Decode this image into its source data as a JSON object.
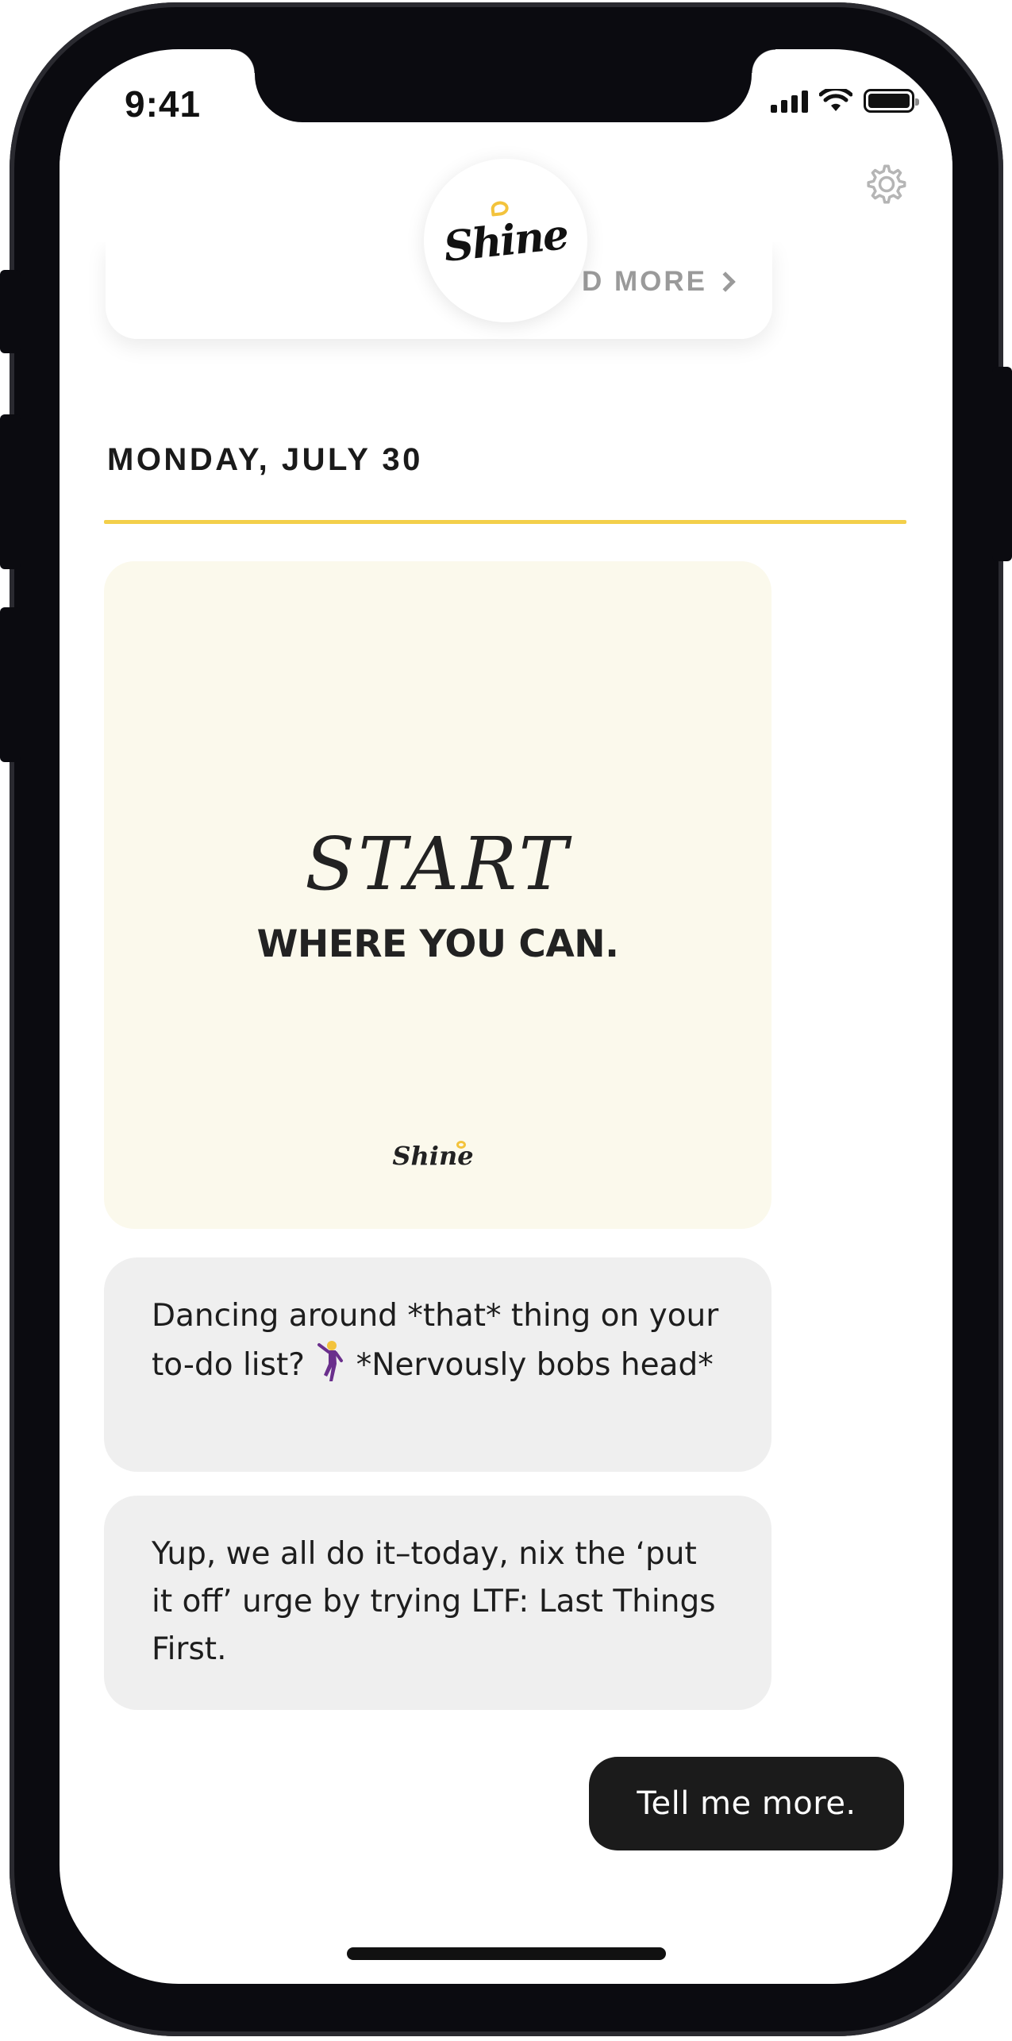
{
  "status_bar": {
    "time": "9:41",
    "icons": [
      "cellular-signal-icon",
      "wifi-icon",
      "battery-icon"
    ]
  },
  "header": {
    "logo_text": "Shine",
    "settings_icon": "gear-icon"
  },
  "previous_card": {
    "link_label": "D MORE"
  },
  "feed": {
    "date_heading": "MONDAY, JULY 30",
    "quote_card": {
      "line1": "START",
      "line2": "WHERE YOU CAN.",
      "brand": "Shine"
    },
    "messages": [
      {
        "before_emoji": "Dancing around *that* thing on your to-do list?",
        "emoji": "person-dancing-emoji",
        "after_emoji": "*Nervously bobs head*"
      },
      {
        "text": "Yup, we all do it–today, nix the ‘put it off’ urge by trying LTF: Last Things First."
      }
    ],
    "reply_button": "Tell me more."
  },
  "colors": {
    "accent_yellow": "#f3cf4a",
    "quote_bg": "#fbf9ec",
    "bubble_bg": "#efefef",
    "reply_bg": "#1b1b1b"
  }
}
